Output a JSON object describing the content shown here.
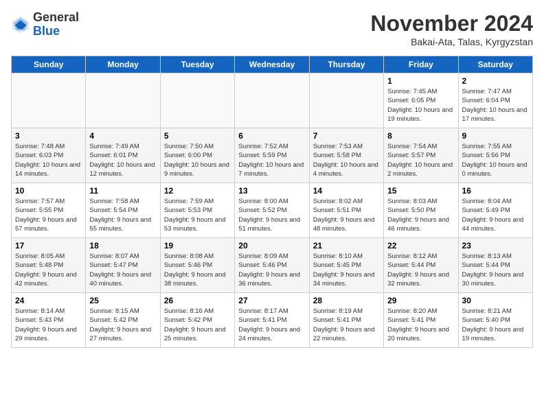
{
  "header": {
    "logo_general": "General",
    "logo_blue": "Blue",
    "month_year": "November 2024",
    "location": "Bakai-Ata, Talas, Kyrgyzstan"
  },
  "weekdays": [
    "Sunday",
    "Monday",
    "Tuesday",
    "Wednesday",
    "Thursday",
    "Friday",
    "Saturday"
  ],
  "weeks": [
    {
      "days": [
        {
          "num": "",
          "info": ""
        },
        {
          "num": "",
          "info": ""
        },
        {
          "num": "",
          "info": ""
        },
        {
          "num": "",
          "info": ""
        },
        {
          "num": "",
          "info": ""
        },
        {
          "num": "1",
          "info": "Sunrise: 7:45 AM\nSunset: 6:05 PM\nDaylight: 10 hours and 19 minutes."
        },
        {
          "num": "2",
          "info": "Sunrise: 7:47 AM\nSunset: 6:04 PM\nDaylight: 10 hours and 17 minutes."
        }
      ]
    },
    {
      "days": [
        {
          "num": "3",
          "info": "Sunrise: 7:48 AM\nSunset: 6:03 PM\nDaylight: 10 hours and 14 minutes."
        },
        {
          "num": "4",
          "info": "Sunrise: 7:49 AM\nSunset: 6:01 PM\nDaylight: 10 hours and 12 minutes."
        },
        {
          "num": "5",
          "info": "Sunrise: 7:50 AM\nSunset: 6:00 PM\nDaylight: 10 hours and 9 minutes."
        },
        {
          "num": "6",
          "info": "Sunrise: 7:52 AM\nSunset: 5:59 PM\nDaylight: 10 hours and 7 minutes."
        },
        {
          "num": "7",
          "info": "Sunrise: 7:53 AM\nSunset: 5:58 PM\nDaylight: 10 hours and 4 minutes."
        },
        {
          "num": "8",
          "info": "Sunrise: 7:54 AM\nSunset: 5:57 PM\nDaylight: 10 hours and 2 minutes."
        },
        {
          "num": "9",
          "info": "Sunrise: 7:55 AM\nSunset: 5:56 PM\nDaylight: 10 hours and 0 minutes."
        }
      ]
    },
    {
      "days": [
        {
          "num": "10",
          "info": "Sunrise: 7:57 AM\nSunset: 5:55 PM\nDaylight: 9 hours and 57 minutes."
        },
        {
          "num": "11",
          "info": "Sunrise: 7:58 AM\nSunset: 5:54 PM\nDaylight: 9 hours and 55 minutes."
        },
        {
          "num": "12",
          "info": "Sunrise: 7:59 AM\nSunset: 5:53 PM\nDaylight: 9 hours and 53 minutes."
        },
        {
          "num": "13",
          "info": "Sunrise: 8:00 AM\nSunset: 5:52 PM\nDaylight: 9 hours and 51 minutes."
        },
        {
          "num": "14",
          "info": "Sunrise: 8:02 AM\nSunset: 5:51 PM\nDaylight: 9 hours and 48 minutes."
        },
        {
          "num": "15",
          "info": "Sunrise: 8:03 AM\nSunset: 5:50 PM\nDaylight: 9 hours and 46 minutes."
        },
        {
          "num": "16",
          "info": "Sunrise: 8:04 AM\nSunset: 5:49 PM\nDaylight: 9 hours and 44 minutes."
        }
      ]
    },
    {
      "days": [
        {
          "num": "17",
          "info": "Sunrise: 8:05 AM\nSunset: 5:48 PM\nDaylight: 9 hours and 42 minutes."
        },
        {
          "num": "18",
          "info": "Sunrise: 8:07 AM\nSunset: 5:47 PM\nDaylight: 9 hours and 40 minutes."
        },
        {
          "num": "19",
          "info": "Sunrise: 8:08 AM\nSunset: 5:46 PM\nDaylight: 9 hours and 38 minutes."
        },
        {
          "num": "20",
          "info": "Sunrise: 8:09 AM\nSunset: 5:46 PM\nDaylight: 9 hours and 36 minutes."
        },
        {
          "num": "21",
          "info": "Sunrise: 8:10 AM\nSunset: 5:45 PM\nDaylight: 9 hours and 34 minutes."
        },
        {
          "num": "22",
          "info": "Sunrise: 8:12 AM\nSunset: 5:44 PM\nDaylight: 9 hours and 32 minutes."
        },
        {
          "num": "23",
          "info": "Sunrise: 8:13 AM\nSunset: 5:44 PM\nDaylight: 9 hours and 30 minutes."
        }
      ]
    },
    {
      "days": [
        {
          "num": "24",
          "info": "Sunrise: 8:14 AM\nSunset: 5:43 PM\nDaylight: 9 hours and 29 minutes."
        },
        {
          "num": "25",
          "info": "Sunrise: 8:15 AM\nSunset: 5:42 PM\nDaylight: 9 hours and 27 minutes."
        },
        {
          "num": "26",
          "info": "Sunrise: 8:16 AM\nSunset: 5:42 PM\nDaylight: 9 hours and 25 minutes."
        },
        {
          "num": "27",
          "info": "Sunrise: 8:17 AM\nSunset: 5:41 PM\nDaylight: 9 hours and 24 minutes."
        },
        {
          "num": "28",
          "info": "Sunrise: 8:19 AM\nSunset: 5:41 PM\nDaylight: 9 hours and 22 minutes."
        },
        {
          "num": "29",
          "info": "Sunrise: 8:20 AM\nSunset: 5:41 PM\nDaylight: 9 hours and 20 minutes."
        },
        {
          "num": "30",
          "info": "Sunrise: 8:21 AM\nSunset: 5:40 PM\nDaylight: 9 hours and 19 minutes."
        }
      ]
    }
  ]
}
